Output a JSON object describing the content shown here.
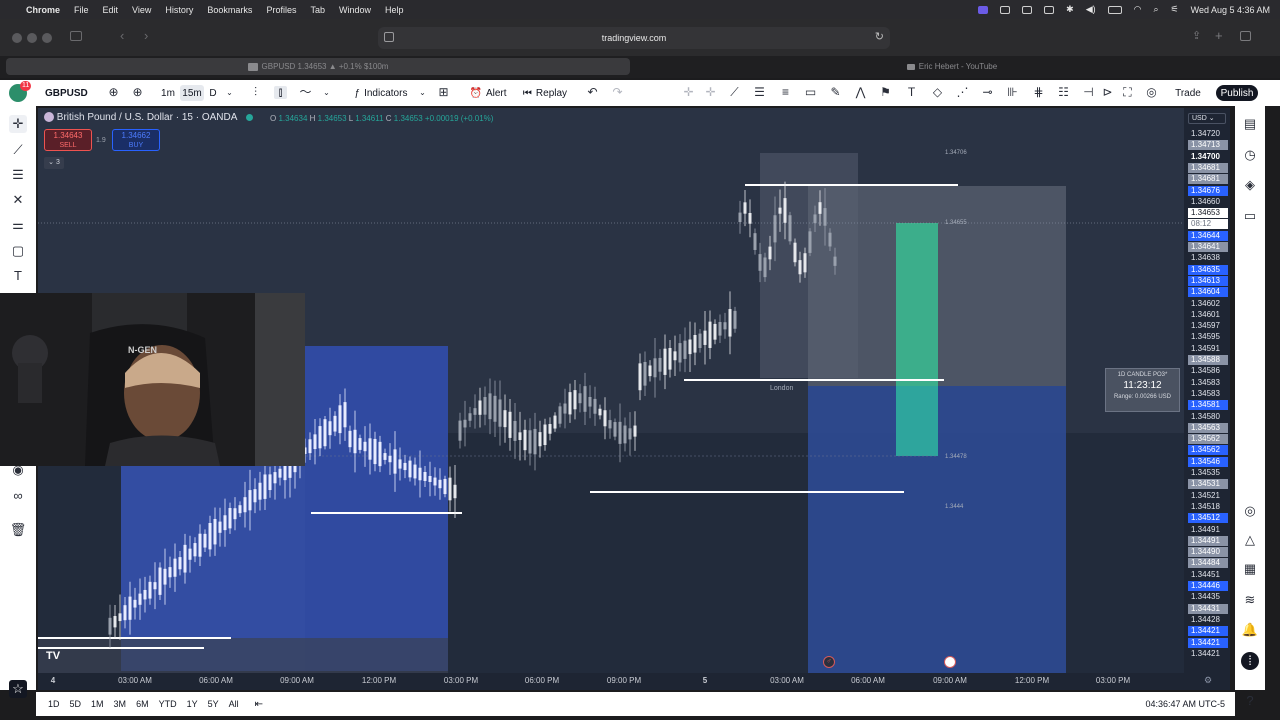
{
  "menubar": {
    "app": "Chrome",
    "items": [
      "File",
      "Edit",
      "View",
      "History",
      "Bookmarks",
      "Profiles",
      "Tab",
      "Window",
      "Help"
    ],
    "datetime": "Wed Aug 5  4:36 AM"
  },
  "browser": {
    "url": "tradingview.com",
    "tabs": [
      {
        "label": "GBPUSD 1.34653 ▲ +0.1% $100m",
        "icon": "tradingview-icon"
      },
      {
        "label": "Eric Hebert - YouTube",
        "icon": "youtube-icon"
      }
    ]
  },
  "toolbar": {
    "notification_count": "11",
    "symbol": "GBPUSD",
    "intervals": [
      "1m",
      "15m",
      "D"
    ],
    "indicators": "Indicators",
    "alert": "Alert",
    "replay": "Replay",
    "trade": "Trade",
    "publish": "Publish"
  },
  "legend": {
    "title": "British Pound / U.S. Dollar · 15 · OANDA",
    "ohlc": [
      {
        "k": "O",
        "v": "1.34634"
      },
      {
        "k": "H",
        "v": "1.34653"
      },
      {
        "k": "L",
        "v": "1.34611"
      },
      {
        "k": "C",
        "v": "1.34653"
      }
    ],
    "change": "+0.00019 (+0.01%)",
    "sell_price": "1.34643",
    "sell_label": "SELL",
    "spread": "1.9",
    "buy_price": "1.34662",
    "buy_label": "BUY",
    "collapsed_count": "3"
  },
  "annotations": {
    "session_label": "London",
    "level_top": "1.34706",
    "level_mid": "1.34655",
    "level_low": "1.34478",
    "level_bottom": "1.3444",
    "range_title": "1D CANDLE PO3*",
    "countdown": "11:23:12",
    "range_text": "Range: 0.00266 USD"
  },
  "price_axis": {
    "currency": "USD",
    "labels": [
      {
        "t": "1.34720",
        "s": "plain"
      },
      {
        "t": "1.34713",
        "s": "gray"
      },
      {
        "t": "1.34700",
        "s": "bold"
      },
      {
        "t": "1.34681",
        "s": "gray"
      },
      {
        "t": "1.34681",
        "s": "gray"
      },
      {
        "t": "1.34676",
        "s": "blue"
      },
      {
        "t": "1.34660",
        "s": "plain"
      },
      {
        "t": "1.34653",
        "s": "white"
      },
      {
        "t": "08:12",
        "s": "timer"
      },
      {
        "t": "1.34644",
        "s": "blue"
      },
      {
        "t": "1.34641",
        "s": "gray"
      },
      {
        "t": "1.34638",
        "s": "plain"
      },
      {
        "t": "1.34635",
        "s": "blue"
      },
      {
        "t": "1.34613",
        "s": "blue"
      },
      {
        "t": "1.34604",
        "s": "blue"
      },
      {
        "t": "1.34602",
        "s": "plain"
      },
      {
        "t": "1.34601",
        "s": "plain"
      },
      {
        "t": "1.34597",
        "s": "plain"
      },
      {
        "t": "1.34595",
        "s": "plain"
      },
      {
        "t": "1.34591",
        "s": "plain"
      },
      {
        "t": "1.34588",
        "s": "gray"
      },
      {
        "t": "1.34586",
        "s": "plain"
      },
      {
        "t": "1.34583",
        "s": "plain"
      },
      {
        "t": "1.34583",
        "s": "plain"
      },
      {
        "t": "1.34581",
        "s": "blue"
      },
      {
        "t": "1.34580",
        "s": "plain"
      },
      {
        "t": "1.34563",
        "s": "gray"
      },
      {
        "t": "1.34562",
        "s": "gray"
      },
      {
        "t": "1.34562",
        "s": "blue"
      },
      {
        "t": "1.34546",
        "s": "blue"
      },
      {
        "t": "1.34535",
        "s": "plain"
      },
      {
        "t": "1.34531",
        "s": "gray"
      },
      {
        "t": "1.34521",
        "s": "plain"
      },
      {
        "t": "1.34518",
        "s": "plain"
      },
      {
        "t": "1.34512",
        "s": "blue"
      },
      {
        "t": "1.34491",
        "s": "plain"
      },
      {
        "t": "1.34491",
        "s": "gray"
      },
      {
        "t": "1.34490",
        "s": "gray"
      },
      {
        "t": "1.34484",
        "s": "gray"
      },
      {
        "t": "1.34451",
        "s": "plain"
      },
      {
        "t": "1.34446",
        "s": "blue"
      },
      {
        "t": "1.34435",
        "s": "plain"
      },
      {
        "t": "1.34431",
        "s": "gray"
      },
      {
        "t": "1.34428",
        "s": "plain"
      },
      {
        "t": "1.34421",
        "s": "blue"
      },
      {
        "t": "1.34421",
        "s": "blue"
      },
      {
        "t": "1.34421",
        "s": "plain"
      }
    ]
  },
  "time_axis": {
    "labels": [
      "4",
      "03:00 AM",
      "06:00 AM",
      "09:00 AM",
      "12:00 PM",
      "03:00 PM",
      "06:00 PM",
      "09:00 PM",
      "5",
      "03:00 AM",
      "06:00 AM",
      "09:00 AM",
      "12:00 PM",
      "03:00 PM"
    ]
  },
  "bottom": {
    "ranges": [
      "1D",
      "5D",
      "1M",
      "3M",
      "6M",
      "YTD",
      "1Y",
      "5Y",
      "All"
    ],
    "clock": "04:36:47 AM UTC-5"
  },
  "webcam": {
    "cap_text": "N-GEN"
  },
  "colors": {
    "chart_bg": "#2a3344",
    "axis_bg": "#1e2533",
    "blue_box": "#3a5bbf",
    "green_box": "#3cb08a",
    "accent": "#2962ff"
  }
}
